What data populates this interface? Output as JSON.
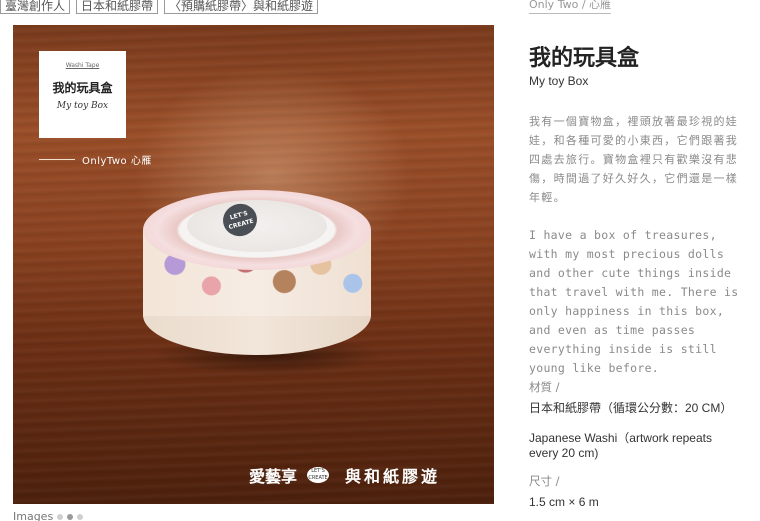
{
  "tags": [
    "臺灣創作人",
    "日本和紙膠帶",
    "〈預購紙膠帶〉與和紙膠遊"
  ],
  "photo": {
    "card_small": "Washi Tape",
    "card_title_zh": "我的玩具盒",
    "card_title_en": "My toy Box",
    "brand": "OnlyTwo 心雁",
    "tape_badge": "LET'S CREATE",
    "caption_left": "愛藝享",
    "caption_badge": "LET'S CREATE",
    "caption_right": "與和紙膠遊"
  },
  "gallery": {
    "label": "Images",
    "dots": 3,
    "active_index": 1
  },
  "product": {
    "designer": "Only Two / 心雁",
    "title": "我的玩具盒",
    "subtitle": "My toy Box",
    "description_zh": "我有一個寶物盒，裡頭放著最珍視的娃娃，和各種可愛的小東西，它們跟著我四處去旅行。寶物盒裡只有歡樂沒有悲傷，時間過了好久好久，它們還是一樣年輕。",
    "description_en": "I have a box of treasures, with my most precious dolls and other cute things inside that travel with me. There is only happiness in this box, and even as time passes everything inside is still young like before.",
    "material_label": "材質 /",
    "material_zh": "日本和紙膠帶（循環公分數：20 CM）",
    "material_en": "Japanese Washi（artwork repeats every 20 cm)",
    "size_label": "尺寸 /",
    "size_value": "1.5 cm × 6 m"
  }
}
